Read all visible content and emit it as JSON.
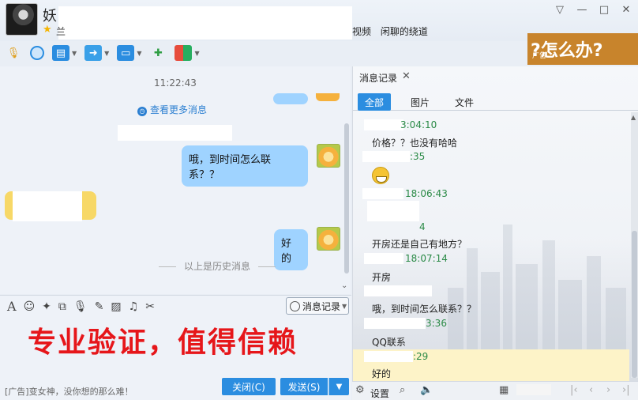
{
  "header": {
    "name": "妖",
    "star_text": "兰",
    "links": [
      "视频",
      "闲聊的绕道"
    ],
    "window_buttons": [
      "▽",
      "—",
      "□",
      "✕"
    ]
  },
  "ad_banner": {
    "text": "?怎么办?",
    "label": "广告"
  },
  "chat": {
    "time": "11:22:43",
    "more_messages": "查看更多消息",
    "messages": [
      {
        "side": "right",
        "text": "哦，到时间怎么联系？？"
      },
      {
        "side": "right",
        "text": "好的"
      }
    ],
    "history_divider": "以上是历史消息"
  },
  "input_toolbar": {
    "icons": [
      "font-icon",
      "emoji-icon",
      "magic-icon",
      "screenshot-icon",
      "voice-icon",
      "edit-icon",
      "image-icon",
      "music-icon",
      "scissors-icon"
    ],
    "history_button": "消息记录"
  },
  "watermark": "专业验证，值得信赖",
  "bottom": {
    "ad_text": "[广告]变女神，没你想的那么难！",
    "close_label": "关闭(C)",
    "send_label": "发送(S)",
    "send_arrow": "▼"
  },
  "history_panel": {
    "title": "消息记录",
    "tabs": [
      "全部",
      "图片",
      "文件"
    ],
    "entries": [
      {
        "time": "3:04:10",
        "msg": "价格？？也没有哈哈"
      },
      {
        "time": ":35",
        "msg": ""
      },
      {
        "time": "18:06:43",
        "msg": ""
      },
      {
        "time": "4",
        "msg": "开房还是自己有地方？"
      },
      {
        "time": "18:07:14",
        "msg": "开房"
      },
      {
        "time": "",
        "msg": "哦，到时间怎么联系？？"
      },
      {
        "time": "3:36",
        "msg": "QQ联系"
      },
      {
        "time": ":29",
        "msg": "好的"
      }
    ],
    "bottom": {
      "settings_label": "设置"
    }
  }
}
